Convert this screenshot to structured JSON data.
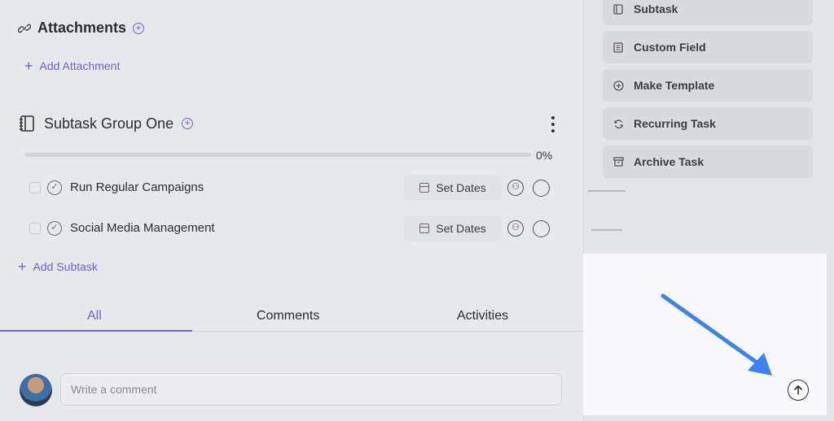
{
  "attachments": {
    "title": "Attachments",
    "add_label": "Add Attachment"
  },
  "subtask_group": {
    "title": "Subtask Group One",
    "progress_percent": 0,
    "progress_label": "0%",
    "tasks": [
      {
        "name": "Run Regular Campaigns",
        "dates_label": "Set Dates"
      },
      {
        "name": "Social Media Management",
        "dates_label": "Set Dates"
      }
    ],
    "add_label": "Add Subtask"
  },
  "tabs": [
    {
      "label": "All",
      "active": true
    },
    {
      "label": "Comments",
      "active": false
    },
    {
      "label": "Activities",
      "active": false
    }
  ],
  "comment": {
    "placeholder": "Write a comment"
  },
  "side_menu": [
    {
      "label": "Subtask",
      "icon": "subtask-icon"
    },
    {
      "label": "Custom Field",
      "icon": "custom-field-icon"
    },
    {
      "label": "Make Template",
      "icon": "plus-circle-icon"
    },
    {
      "label": "Recurring Task",
      "icon": "refresh-icon"
    },
    {
      "label": "Archive Task",
      "icon": "archive-icon"
    }
  ],
  "colors": {
    "accent": "#6b63d6",
    "annotation_arrow": "#3b82f6"
  }
}
